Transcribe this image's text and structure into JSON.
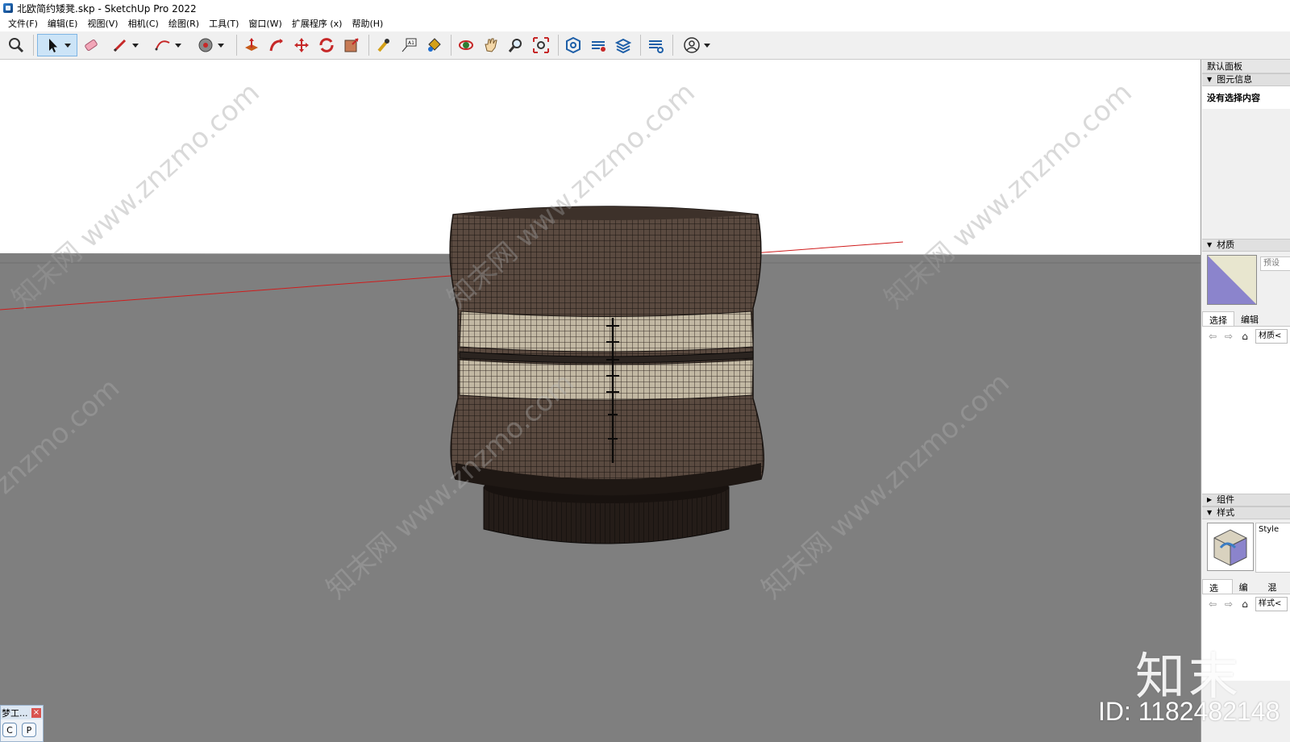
{
  "window": {
    "title": "北欧简约矮凳.skp - SketchUp Pro 2022"
  },
  "menu": [
    "文件(F)",
    "编辑(E)",
    "视图(V)",
    "相机(C)",
    "绘图(R)",
    "工具(T)",
    "窗口(W)",
    "扩展程序 (x)",
    "帮助(H)"
  ],
  "toolbar": {
    "tools": [
      "search-icon",
      "select-icon",
      "eraser-icon",
      "pencil-icon",
      "arc-icon",
      "shape-icon",
      "push-pull-icon",
      "follow-me-icon",
      "move-icon",
      "rotate-icon",
      "scale-icon",
      "tape-measure-icon",
      "text-icon",
      "paint-bucket-icon",
      "orbit-icon",
      "pan-icon",
      "zoom-icon",
      "zoom-extents-icon",
      "warehouse-icon",
      "extension-warehouse-icon",
      "layout-icon",
      "extension-manager-icon",
      "account-icon"
    ]
  },
  "panel": {
    "title": "默认面板",
    "entity_info": {
      "header": "图元信息",
      "content": "没有选择内容"
    },
    "materials": {
      "header": "材质",
      "name": "预设",
      "tab_select": "选择",
      "tab_edit": "编辑",
      "collection": "材质<"
    },
    "components": {
      "header": "组件"
    },
    "styles": {
      "header": "样式",
      "name": "Style",
      "tab_select": "选择",
      "tab_edit": "编辑",
      "tab_mix": "混合",
      "collection": "样式<"
    }
  },
  "mini_toolbar": {
    "title": "梦工..."
  },
  "watermark": {
    "site": "知末网 www.znzmo.com",
    "site_short": "znzmo.com",
    "logo": "知末",
    "id": "ID: 1182482148"
  },
  "colors": {
    "sky": "#ffffff",
    "ground": "#7f7f7f",
    "ottoman_body": "#4a3b33",
    "band": "#bfb4a0",
    "base": "#1c1613",
    "axis_red": "#d01c1c"
  }
}
